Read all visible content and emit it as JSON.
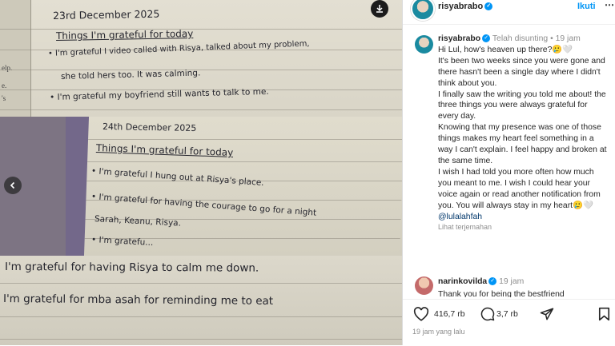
{
  "media": {
    "note1": {
      "margin_lines": [
        "elp.",
        "e.",
        "'s"
      ],
      "date": "23rd December 2025",
      "title": "Things I'm grateful for today",
      "lines": [
        "• I'm grateful I video called with Risya, talked about my problem,",
        "she told hers too. It was calming.",
        "• I'm grateful my boyfriend still wants to talk to me."
      ]
    },
    "note2": {
      "date": "24th December 2025",
      "title": "Things I'm grateful for today",
      "lines": [
        "• I'm grateful I hung out at Risya's place.",
        "• I'm grateful for having the courage to go for a night",
        "Sarah, Keanu, Risya.",
        "• I'm gratefu..."
      ]
    },
    "note3": {
      "lines": [
        "I'm grateful for having Risya to calm me down.",
        "I'm grateful for mba asah for reminding me to eat"
      ]
    }
  },
  "header": {
    "username": "risyabrabo",
    "follow_label": "Ikuti",
    "more_label": "⋯"
  },
  "caption": {
    "username": "risyabrabo",
    "edited": "Telah disunting",
    "time": "19 jam",
    "paragraphs": [
      "Hi Lul, how's heaven up there?🥲🤍",
      "It's been two weeks since you were gone and there hasn't been a single day where I didn't think about you.",
      "I finally saw the writing you told me about! the three things you were always grateful for every day.",
      "Knowing that my presence was one of those things makes my heart feel something in a way I can't explain. I feel happy and broken at the same time.",
      "I wish I had told you more often how much you meant to me. I wish I could hear your voice again or read another notification from you. You will always stay in my heart🥲🤍"
    ],
    "mention": "@lulalahfah",
    "translate_label": "Lihat terjemahan"
  },
  "comment2": {
    "username": "narinkovilda",
    "time": "19 jam",
    "text": "Thank you for being the bestfriend"
  },
  "actions": {
    "likes": "416,7 rb",
    "comments": "3,7 rb",
    "post_time": "19 jam yang lalu"
  },
  "colors": {
    "accent": "#0095f6",
    "muted": "#8e8e8e",
    "mention": "#00376b"
  }
}
